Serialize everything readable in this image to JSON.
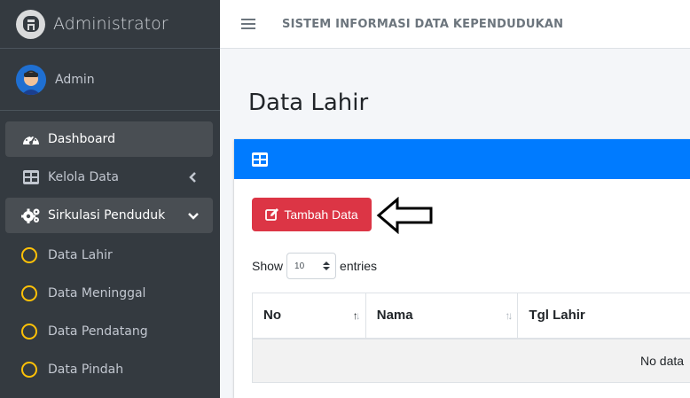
{
  "brand": {
    "title": "Administrator",
    "logo_letter": "A"
  },
  "user": {
    "name": "Admin"
  },
  "sidebar": {
    "items": [
      {
        "label": "Dashboard",
        "icon": "dashboard-gauge-icon"
      },
      {
        "label": "Kelola Data",
        "icon": "table-grid-icon",
        "caret": "chevron-left-icon"
      },
      {
        "label": "Sirkulasi Penduduk",
        "icon": "cogs-icon",
        "caret": "chevron-down-icon"
      }
    ],
    "subitems": [
      {
        "label": "Data Lahir"
      },
      {
        "label": "Data Meninggal"
      },
      {
        "label": "Data Pendatang"
      },
      {
        "label": "Data Pindah"
      }
    ]
  },
  "navbar": {
    "title": "SISTEM INFORMASI DATA KEPENDUDUKAN"
  },
  "page": {
    "title": "Data Lahir"
  },
  "toolbar": {
    "add_label": "Tambah Data"
  },
  "table_controls": {
    "show_label": "Show",
    "entries_label": "entries",
    "page_size": "10"
  },
  "table": {
    "headers": [
      "No",
      "Nama",
      "Tgl Lahir"
    ],
    "empty_text": "No data"
  },
  "colors": {
    "sidebar": "#343a40",
    "primary": "#007bff",
    "danger": "#dc3545",
    "accent": "#ffc107"
  }
}
